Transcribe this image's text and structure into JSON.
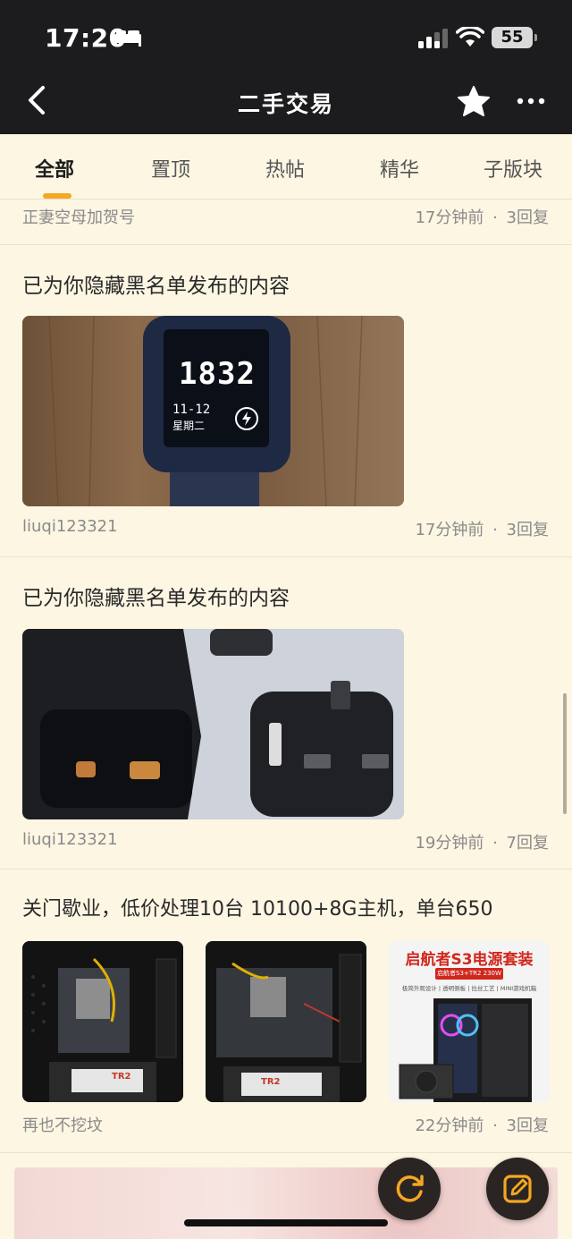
{
  "status_bar": {
    "time": "17:20",
    "battery": "55"
  },
  "nav": {
    "title": "二手交易",
    "back_icon": "chevron-left-icon",
    "favorite_icon": "star-icon",
    "more_icon": "more-dots-icon"
  },
  "tabs": [
    {
      "label": "全部",
      "active": true
    },
    {
      "label": "置顶"
    },
    {
      "label": "热帖"
    },
    {
      "label": "精华"
    },
    {
      "label": "子版块"
    }
  ],
  "posts": [
    {
      "author": "正妻空母加贺号",
      "time": "17分钟前",
      "replies": "3回复"
    },
    {
      "title": "已为你隐藏黑名单发布的内容",
      "author": "liuqi123321",
      "time": "17分钟前",
      "replies": "3回复",
      "image": {
        "kind": "smartwatch-photo",
        "watch_time": "1832",
        "watch_date": "11-12",
        "watch_weekday": "星期二"
      }
    },
    {
      "title": "已为你隐藏黑名单发布的内容",
      "author": "liuqi123321",
      "time": "19分钟前",
      "replies": "7回复",
      "image": {
        "kind": "opened-plug-photo"
      }
    },
    {
      "title": "关门歇业，低价处理10台 10100+8G主机，单台650",
      "author": "再也不挖坟",
      "time": "22分钟前",
      "replies": "3回复",
      "images": [
        {
          "kind": "pc-interior-photo",
          "psu_label": "TR2"
        },
        {
          "kind": "pc-interior-photo",
          "psu_label": "TR2"
        },
        {
          "kind": "pc-case-ad",
          "headline": "启航者S3电源套装",
          "subline": "启航者S3+TR2 230W",
          "features": "极简外观设计 | 透明侧板 | 拉丝工艺 | MINI游戏机箱"
        }
      ]
    }
  ],
  "fabs": {
    "refresh_icon": "refresh-icon",
    "compose_icon": "compose-icon"
  },
  "separator": "·",
  "colors": {
    "accent": "#f5a623",
    "background": "#fcf6e3",
    "topbar": "#1c1c1e"
  }
}
